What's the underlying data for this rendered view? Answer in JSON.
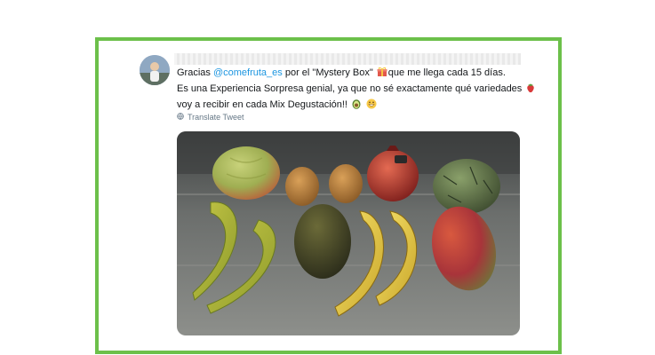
{
  "tweet": {
    "line1_before": "Gracias ",
    "mention": "@comefruta_es",
    "line1_after": " por el \"Mystery Box\"",
    "line1_end": "que me llega cada 15 días.",
    "line2": "Es una Experiencia Sorpresa genial, ya que no sé exactamente qué variedades",
    "line3": "voy a recibir en cada Mix Degustación!!",
    "translate_label": "Translate Tweet"
  },
  "icons": {
    "gift": "gift-icon",
    "strawberry": "strawberry-icon",
    "avocado": "avocado-icon",
    "grin": "grinning-face-icon",
    "globe": "globe-icon"
  },
  "colors": {
    "frame": "#6cc04a",
    "mention": "#1b95e0",
    "text": "#14171a",
    "secondary": "#657786"
  }
}
